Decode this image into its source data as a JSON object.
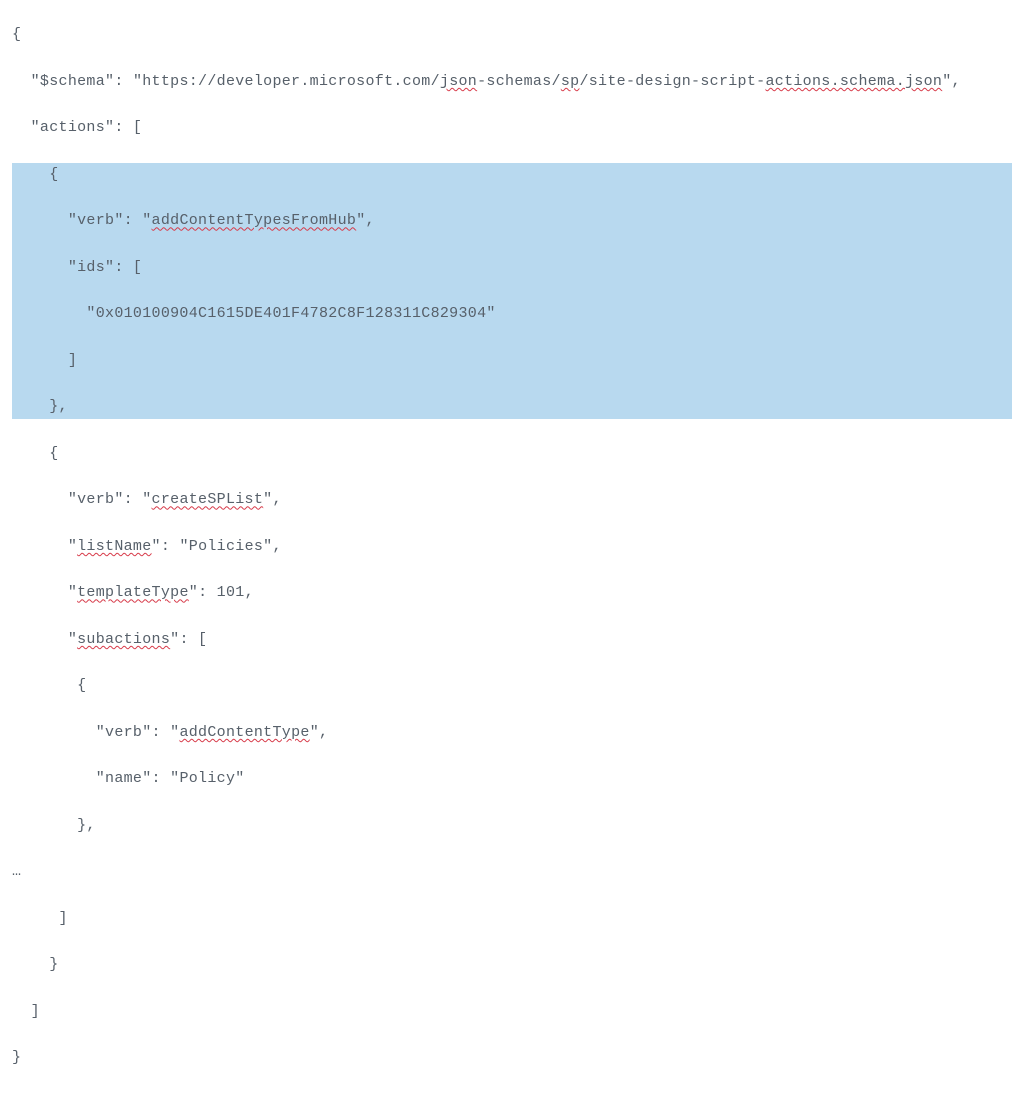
{
  "code": {
    "keys": {
      "schema": "\"$schema\"",
      "actions": "\"actions\"",
      "verb": "\"verb\"",
      "ids": "\"ids\"",
      "listName": "\"listName\"",
      "templateType": "\"templateType\"",
      "subactions": "\"subactions\"",
      "name": "\"name\""
    },
    "values": {
      "schema_url_prefix": "\"https://developer.microsoft.com/",
      "schema_url_wavy1": "json",
      "schema_url_mid": "-schemas/",
      "schema_url_wavy2": "sp",
      "schema_url_mid2": "/site-design-script-",
      "schema_url_wavy3": "actions.schema.json",
      "schema_url_suffix": "\"",
      "verb1": "addContentTypesFromHub",
      "id0": "\"0x010100904C1615DE401F4782C8F128311C829304\"",
      "verb2": "createSPList",
      "listName": "\"Policies\"",
      "templateType": "101",
      "verb3": "addContentType",
      "name": "\"Policy\""
    },
    "wavy": {
      "listName": "listName",
      "templateType": "templateType",
      "subactions": "subactions"
    },
    "ellipsis": "…"
  }
}
